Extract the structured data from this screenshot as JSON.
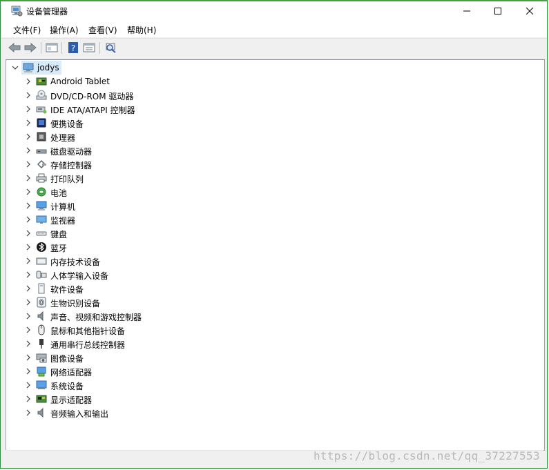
{
  "window": {
    "title": "设备管理器",
    "icon": "device-manager-icon",
    "controls": {
      "minimize_icon": "minimize-icon",
      "maximize_icon": "maximize-icon",
      "close_icon": "close-icon"
    }
  },
  "menu": {
    "items": [
      {
        "label": "文件(F)"
      },
      {
        "label": "操作(A)"
      },
      {
        "label": "查看(V)"
      },
      {
        "label": "帮助(H)"
      }
    ]
  },
  "toolbar": {
    "buttons": [
      {
        "icon": "back-arrow-icon"
      },
      {
        "icon": "forward-arrow-icon"
      },
      {
        "icon": "properties-window-icon"
      },
      {
        "icon": "help-icon"
      },
      {
        "icon": "details-window-icon"
      },
      {
        "icon": "scan-hardware-icon"
      }
    ]
  },
  "tree": {
    "root": {
      "label": "jodys",
      "icon": "computer-icon",
      "expanded": true
    },
    "categories": [
      {
        "label": "Android Tablet",
        "icon": "board-icon"
      },
      {
        "label": "DVD/CD-ROM 驱动器",
        "icon": "disc-drive-icon"
      },
      {
        "label": "IDE ATA/ATAPI 控制器",
        "icon": "ide-controller-icon"
      },
      {
        "label": "便携设备",
        "icon": "portable-device-icon"
      },
      {
        "label": "处理器",
        "icon": "processor-icon"
      },
      {
        "label": "磁盘驱动器",
        "icon": "disk-drive-icon"
      },
      {
        "label": "存储控制器",
        "icon": "storage-controller-icon"
      },
      {
        "label": "打印队列",
        "icon": "printer-icon"
      },
      {
        "label": "电池",
        "icon": "battery-icon"
      },
      {
        "label": "计算机",
        "icon": "monitor-icon"
      },
      {
        "label": "监视器",
        "icon": "display-monitor-icon"
      },
      {
        "label": "键盘",
        "icon": "keyboard-icon"
      },
      {
        "label": "蓝牙",
        "icon": "bluetooth-icon"
      },
      {
        "label": "内存技术设备",
        "icon": "memory-icon"
      },
      {
        "label": "人体学输入设备",
        "icon": "hid-icon"
      },
      {
        "label": "软件设备",
        "icon": "software-device-icon"
      },
      {
        "label": "生物识别设备",
        "icon": "fingerprint-icon"
      },
      {
        "label": "声音、视频和游戏控制器",
        "icon": "speaker-icon"
      },
      {
        "label": "鼠标和其他指针设备",
        "icon": "mouse-icon"
      },
      {
        "label": "通用串行总线控制器",
        "icon": "usb-icon"
      },
      {
        "label": "图像设备",
        "icon": "camera-icon"
      },
      {
        "label": "网络适配器",
        "icon": "network-adapter-icon"
      },
      {
        "label": "系统设备",
        "icon": "system-device-icon"
      },
      {
        "label": "显示适配器",
        "icon": "display-adapter-icon"
      },
      {
        "label": "音频输入和输出",
        "icon": "audio-io-icon"
      }
    ]
  },
  "watermark": "https://blog.csdn.net/qq_37227553",
  "colors": {
    "selection": "#d9ebf9",
    "window_border": "#41a23b"
  }
}
